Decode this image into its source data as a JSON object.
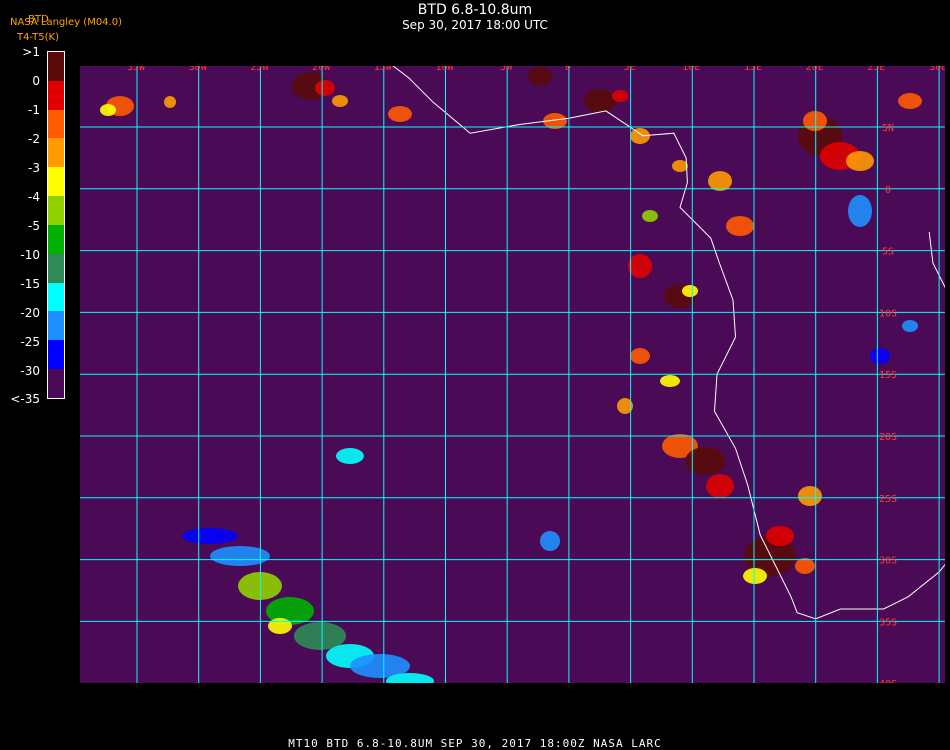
{
  "header": {
    "title": "BTD 6.8-10.8um",
    "subtitle": "Sep 30, 2017 18:00 UTC"
  },
  "source_label": "NASA Langley (M04.0)",
  "legend": {
    "title": "BTD",
    "unit": "T4-T5(K)",
    "ticks": [
      ">1",
      "0",
      "-1",
      "-2",
      "-3",
      "-4",
      "-5",
      "-10",
      "-15",
      "-20",
      "-25",
      "-30",
      "<-35"
    ],
    "colors": [
      "#5a0a0a",
      "#e00000",
      "#ff5a00",
      "#ff9a00",
      "#ffff00",
      "#90d000",
      "#00b000",
      "#2e8b57",
      "#00ffff",
      "#1e90ff",
      "#0000ff",
      "#4b0a55"
    ]
  },
  "map": {
    "background_color": "#4b0a55",
    "grid_color": "#00ffff",
    "coast_color": "#ffffff",
    "label_color": "#ff3a3a",
    "longitude_labels": [
      "35W",
      "30W",
      "25W",
      "20W",
      "15W",
      "10W",
      "5W",
      "0",
      "5E",
      "10E",
      "15E",
      "20E",
      "25E",
      "30E",
      "35E"
    ],
    "latitude_labels": [
      "5N",
      "0",
      "5S",
      "10S",
      "15S",
      "20S",
      "25S",
      "30S",
      "35S",
      "40S"
    ]
  },
  "footer": {
    "text": "MT10  BTD 6.8-10.8UM   SEP 30, 2017 18:00Z   NASA LARC"
  }
}
